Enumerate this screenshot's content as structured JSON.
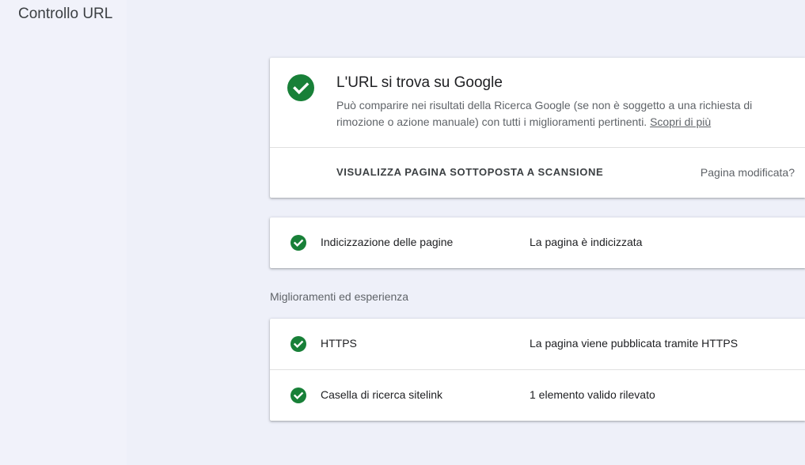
{
  "page": {
    "title": "Controllo URL"
  },
  "status_card": {
    "title": "L'URL si trova su Google",
    "description": "Può comparire nei risultati della Ricerca Google (se non è soggetto a una richiesta di rimozione o azione manuale) con tutti i miglioramenti pertinenti.",
    "learn_more": "Scopri di più",
    "view_crawled_button": "VISUALIZZA PAGINA SOTTOPOSTA A SCANSIONE",
    "modified_link": "Pagina modificata?",
    "status_icon": "check-circle-icon",
    "status_color": "#188038"
  },
  "indexing": {
    "label": "Indicizzazione delle pagine",
    "value": "La pagina è indicizzata",
    "icon": "check-circle-icon"
  },
  "enhancements": {
    "heading": "Miglioramenti ed esperienza",
    "items": [
      {
        "label": "HTTPS",
        "value": "La pagina viene pubblicata tramite HTTPS",
        "icon": "check-circle-icon"
      },
      {
        "label": "Casella di ricerca sitelink",
        "value": "1 elemento valido rilevato",
        "icon": "check-circle-icon"
      }
    ]
  }
}
